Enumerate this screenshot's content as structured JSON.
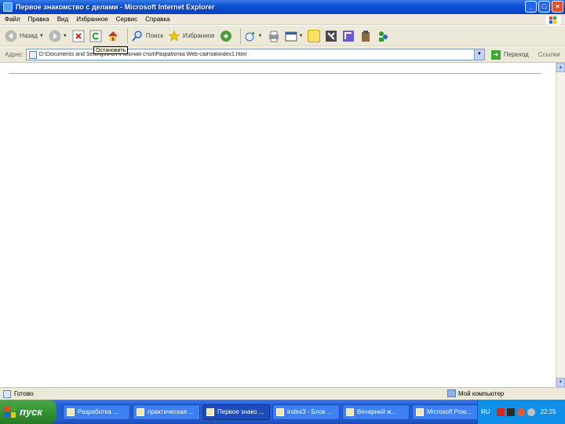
{
  "window": {
    "title": "Первое знакомство с делами - Microsoft Internet Explorer",
    "minimize": "_",
    "maximize": "□",
    "close": "×"
  },
  "menu": [
    "Файл",
    "Правка",
    "Вид",
    "Избранное",
    "Сервис",
    "Справка"
  ],
  "toolbar": {
    "back_label": "Назад",
    "search_label": "Поиск",
    "favorites_label": "Избранное",
    "tooltip": "Остановить"
  },
  "address": {
    "label": "Адрес",
    "url": "D:\\Documents and Settings\\ИВТ\\Рабочий стол\\Разработка Web-сайтов\\index1.html",
    "go_label": "Переход",
    "links_label": "Ссылки"
  },
  "status": {
    "text": "Готово",
    "zone": "Мой компьютер"
  },
  "taskbar": {
    "start_label": "пуск",
    "tasks": [
      "Разработка ...",
      "практическая ...",
      "Первое знако ...",
      "index3 - Блок ...",
      "Вечерний ж...",
      "Microsoft Pow..."
    ],
    "active_task": 2,
    "lang": "RU",
    "clock": "22:25"
  },
  "colors": {
    "title_blue": "#0a4fd4",
    "chrome_beige": "#ece9d8",
    "taskbar_blue": "#235ed4",
    "start_green": "#2f8f2e",
    "tray_blue": "#0f8fe8"
  }
}
